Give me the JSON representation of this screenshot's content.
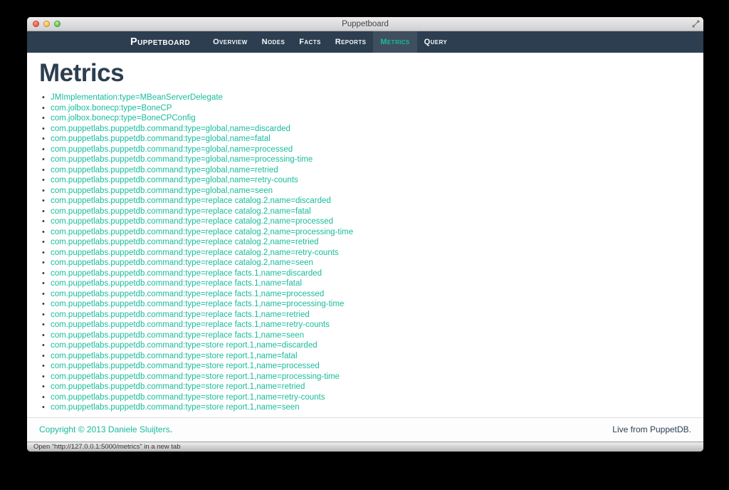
{
  "window": {
    "title": "Puppetboard",
    "status_text": "Open “http://127.0.0.1:5000/metrics” in a new tab"
  },
  "navbar": {
    "brand": "Puppetboard",
    "items": [
      {
        "label": "Overview",
        "active": false
      },
      {
        "label": "Nodes",
        "active": false
      },
      {
        "label": "Facts",
        "active": false
      },
      {
        "label": "Reports",
        "active": false
      },
      {
        "label": "Metrics",
        "active": true
      },
      {
        "label": "Query",
        "active": false
      }
    ]
  },
  "main": {
    "heading": "Metrics",
    "metrics": [
      "JMImplementation:type=MBeanServerDelegate",
      "com.jolbox.bonecp:type=BoneCP",
      "com.jolbox.bonecp:type=BoneCPConfig",
      "com.puppetlabs.puppetdb.command:type=global,name=discarded",
      "com.puppetlabs.puppetdb.command:type=global,name=fatal",
      "com.puppetlabs.puppetdb.command:type=global,name=processed",
      "com.puppetlabs.puppetdb.command:type=global,name=processing-time",
      "com.puppetlabs.puppetdb.command:type=global,name=retried",
      "com.puppetlabs.puppetdb.command:type=global,name=retry-counts",
      "com.puppetlabs.puppetdb.command:type=global,name=seen",
      "com.puppetlabs.puppetdb.command:type=replace catalog.2,name=discarded",
      "com.puppetlabs.puppetdb.command:type=replace catalog.2,name=fatal",
      "com.puppetlabs.puppetdb.command:type=replace catalog.2,name=processed",
      "com.puppetlabs.puppetdb.command:type=replace catalog.2,name=processing-time",
      "com.puppetlabs.puppetdb.command:type=replace catalog.2,name=retried",
      "com.puppetlabs.puppetdb.command:type=replace catalog.2,name=retry-counts",
      "com.puppetlabs.puppetdb.command:type=replace catalog.2,name=seen",
      "com.puppetlabs.puppetdb.command:type=replace facts.1,name=discarded",
      "com.puppetlabs.puppetdb.command:type=replace facts.1,name=fatal",
      "com.puppetlabs.puppetdb.command:type=replace facts.1,name=processed",
      "com.puppetlabs.puppetdb.command:type=replace facts.1,name=processing-time",
      "com.puppetlabs.puppetdb.command:type=replace facts.1,name=retried",
      "com.puppetlabs.puppetdb.command:type=replace facts.1,name=retry-counts",
      "com.puppetlabs.puppetdb.command:type=replace facts.1,name=seen",
      "com.puppetlabs.puppetdb.command:type=store report.1,name=discarded",
      "com.puppetlabs.puppetdb.command:type=store report.1,name=fatal",
      "com.puppetlabs.puppetdb.command:type=store report.1,name=processed",
      "com.puppetlabs.puppetdb.command:type=store report.1,name=processing-time",
      "com.puppetlabs.puppetdb.command:type=store report.1,name=retried",
      "com.puppetlabs.puppetdb.command:type=store report.1,name=retry-counts",
      "com.puppetlabs.puppetdb.command:type=store report.1,name=seen"
    ]
  },
  "footer": {
    "copyright_link": "Copyright © 2013 Daniele Sluijters",
    "copyright_suffix": ".",
    "live_text": "Live from PuppetDB."
  },
  "colors": {
    "accent": "#18bc9c",
    "navbar_bg": "#2c3e50",
    "navy": "#2c3e50"
  }
}
